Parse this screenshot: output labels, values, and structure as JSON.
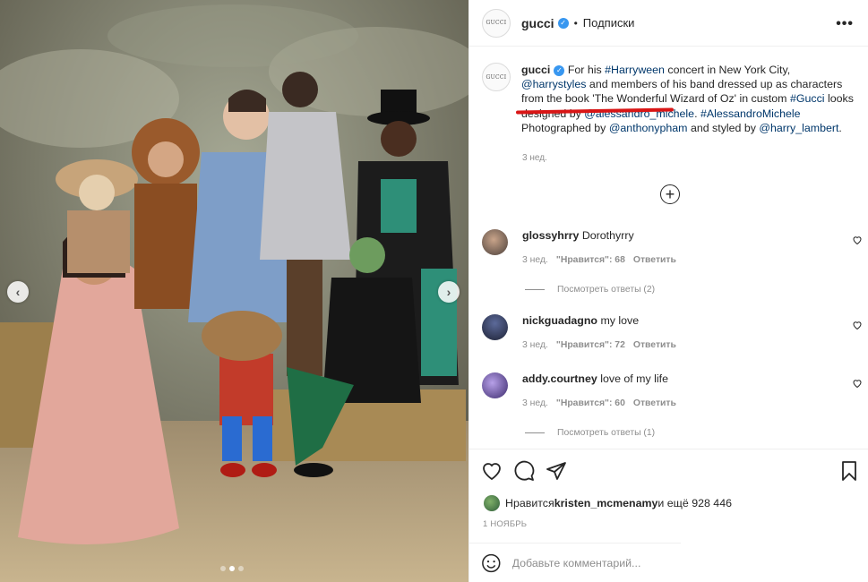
{
  "post": {
    "author": "gucci",
    "separator": "•",
    "follow_label": "Подписки",
    "avatar_text": "GUCCI",
    "more_icon": "more-horizontal-icon"
  },
  "caption": {
    "username": "gucci",
    "t1": "For his ",
    "tag_harryween": "#Harryween",
    "t2": " concert in New York City, ",
    "mention_harry": "@harrystyles",
    "t3": " and members of his band dressed up as characters from the book ",
    "book": "'The Wonderful Wizard of Oz'",
    "t4": " in custom ",
    "tag_gucci": "#Gucci",
    "t5": " looks designed by ",
    "mention_alessandro": "@alessandro_michele",
    "t6": ". ",
    "tag_alessandro": "#AlessandroMichele",
    "t7": " Photographed by ",
    "mention_anthony": "@anthonypham",
    "t8": " and styled by ",
    "mention_harry_lambert": "@harry_lambert",
    "t9": ".",
    "time": "3 нед."
  },
  "comments": [
    {
      "username": "glossyhrry",
      "text": "Dorothyrry",
      "time": "3 нед.",
      "likes": "\"Нравится\": 68",
      "reply": "Ответить",
      "view_replies": "Посмотреть ответы (2)",
      "avatar_color": "#4a3f3a"
    },
    {
      "username": "nickguadagno",
      "text": "my love",
      "time": "3 нед.",
      "likes": "\"Нравится\": 72",
      "reply": "Ответить",
      "view_replies": "",
      "avatar_color": "#1e2235"
    },
    {
      "username": "addy.courtney",
      "text": "love of my life",
      "time": "3 нед.",
      "likes": "\"Нравится\": 60",
      "reply": "Ответить",
      "view_replies": "Посмотреть ответы (1)",
      "avatar_color": "#5a4a8c"
    }
  ],
  "likes": {
    "prefix": "Нравится ",
    "user": "kristen_mcmenamy",
    "suffix": " и ещё 928 446"
  },
  "date": "1 НОЯБРЬ",
  "add_comment": {
    "placeholder": "Добавьте комментарий..."
  },
  "carousel": {
    "total": 3,
    "active": 2
  }
}
